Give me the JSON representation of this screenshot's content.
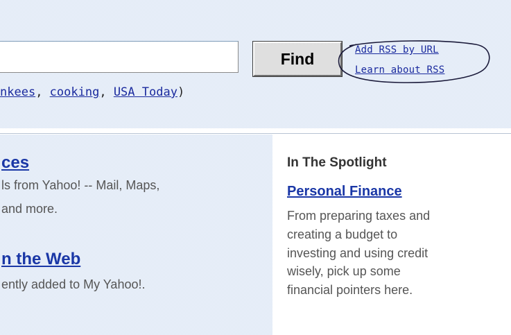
{
  "search": {
    "input_value": "",
    "find_label": "Find",
    "add_rss_label": "Add RSS by URL",
    "learn_rss_label": "Learn about RSS",
    "examples": {
      "item1": "nkees",
      "item2": "cooking",
      "item3": "USA Today",
      "sep1": ", ",
      "sep2": ", ",
      "close": ")"
    }
  },
  "left": {
    "services_heading": "ces",
    "services_line1": "ls from Yahoo! -- Mail, Maps,",
    "services_line2": "and more.",
    "web_heading": "n the Web",
    "web_line1": "ently added to My Yahoo!."
  },
  "spotlight": {
    "title": "In The Spotlight",
    "link": "Personal Finance",
    "lines": [
      "From preparing taxes and",
      "creating a budget to",
      "investing and using credit",
      "wisely, pick up some",
      "financial pointers here."
    ]
  },
  "colors": {
    "link": "#1a37a6",
    "band_background": "#eef3fb",
    "oval_stroke": "#1a1a3a"
  },
  "icons": {
    "rss_oval": "hand-drawn-oval-annotation"
  }
}
